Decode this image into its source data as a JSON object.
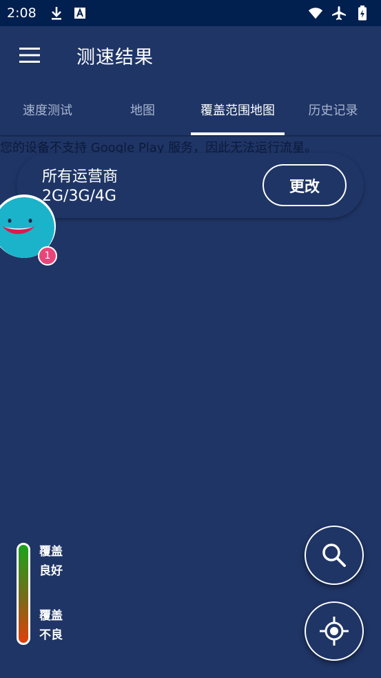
{
  "status_bar": {
    "time": "2:08",
    "icons": [
      "download-icon",
      "text-a-icon",
      "wifi-icon",
      "airplane-icon",
      "battery-icon"
    ]
  },
  "app_bar": {
    "title": "测速结果",
    "menu_icon": "hamburger-menu-icon"
  },
  "tabs": [
    {
      "label": "速度测试",
      "active": false
    },
    {
      "label": "地图",
      "active": false
    },
    {
      "label": "覆盖范围地图",
      "active": true
    },
    {
      "label": "历史记录",
      "active": false
    }
  ],
  "warning_text": "您的设备不支持 Google Play 服务，因此无法运行流星。",
  "carrier": {
    "name": "所有运营商",
    "technology": "2G/3G/4G",
    "change_label": "更改"
  },
  "mascot": {
    "badge_count": "1"
  },
  "legend": {
    "good": [
      "覆盖",
      "良好"
    ],
    "bad": [
      "覆盖",
      "不良"
    ]
  },
  "colors": {
    "background": "#1f3566",
    "status_bar": "#011f4f",
    "tab_inactive": "#a9b6cf",
    "badge": "#e8467a",
    "mascot": "#1bb3c9",
    "legend_good": "#1aa31a",
    "legend_bad": "#e0400a"
  },
  "buttons": {
    "search_icon": "search-icon",
    "locate_icon": "my-location-icon"
  }
}
